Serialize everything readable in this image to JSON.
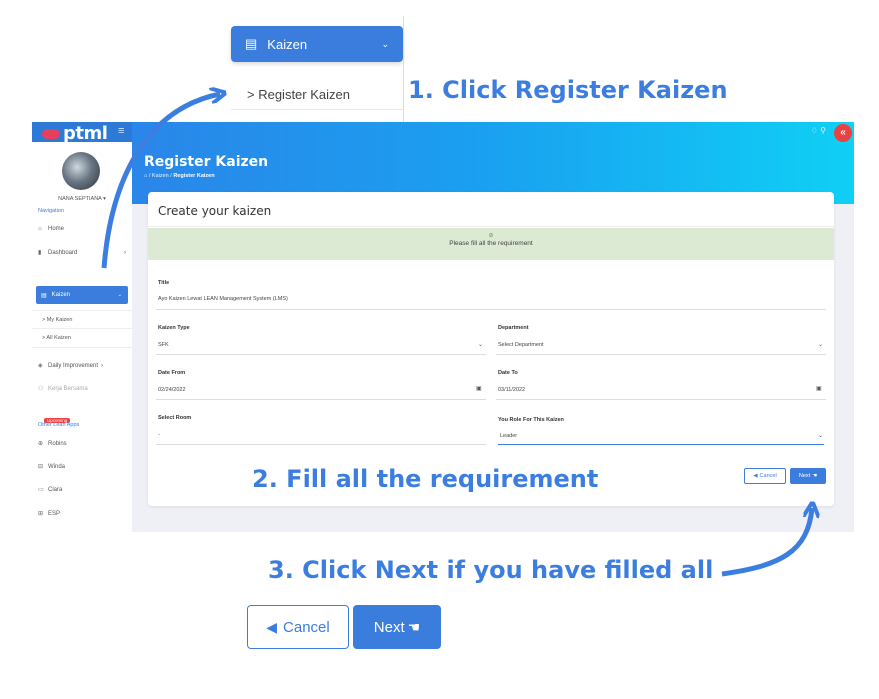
{
  "zoom": {
    "kaizen_label": "Kaizen",
    "register_label": "> Register Kaizen"
  },
  "callouts": {
    "step1": "1. Click Register Kaizen",
    "step2": "2. Fill all the requirement",
    "step3": "3. Click Next if you have filled all"
  },
  "app": {
    "logo": "ptml",
    "menu_toggle": "≡",
    "top_icons": "♢  ⚲",
    "collapse": "«",
    "username": "NANA SEPTIANA ▾",
    "nav_heading": "Navigation",
    "nav": {
      "home": "Home",
      "dashboard": "Dashboard",
      "kaizen": "Kaizen",
      "register_kaizen": "> Register Kaizen",
      "my_kaizen": "> My Kaizen",
      "all_kaizen": "> All Kaizen",
      "daily_improvement": "Daily Improvement",
      "kerja_bersama": "Kerja Bersama",
      "upcoming": "Upcoming"
    },
    "other_heading": "Other Lean Apps",
    "other": {
      "robins": "Robins",
      "winda": "Winda",
      "clara": "Clara",
      "esp": "ESP"
    },
    "page_title": "Register Kaizen",
    "breadcrumb_prefix": "⌂ / Kaizen / ",
    "breadcrumb_current": "Register Kaizen",
    "card_title": "Create your kaizen",
    "alert_text": "Please fill all the requirement",
    "form": {
      "title_label": "Title",
      "title_value": "Ayo Kaizen Lewat LEAN Management System (LMS)",
      "type_label": "Kaizen Type",
      "type_value": "SFK",
      "dept_label": "Department",
      "dept_value": "Select Department",
      "date_from_label": "Date From",
      "date_from_value": "02/24/2022",
      "date_to_label": "Date To",
      "date_to_value": "03/11/2022",
      "room_label": "Select Room",
      "room_value": "-",
      "role_label": "You Role For This Kaizen",
      "role_value": "Leader"
    },
    "cancel_label": "Cancel",
    "next_label": "Next"
  },
  "big_buttons": {
    "cancel_label": "Cancel",
    "next_label": "Next"
  },
  "colors": {
    "accent": "#3b7ddd",
    "callout": "#3c7ee0",
    "danger": "#e84242"
  }
}
